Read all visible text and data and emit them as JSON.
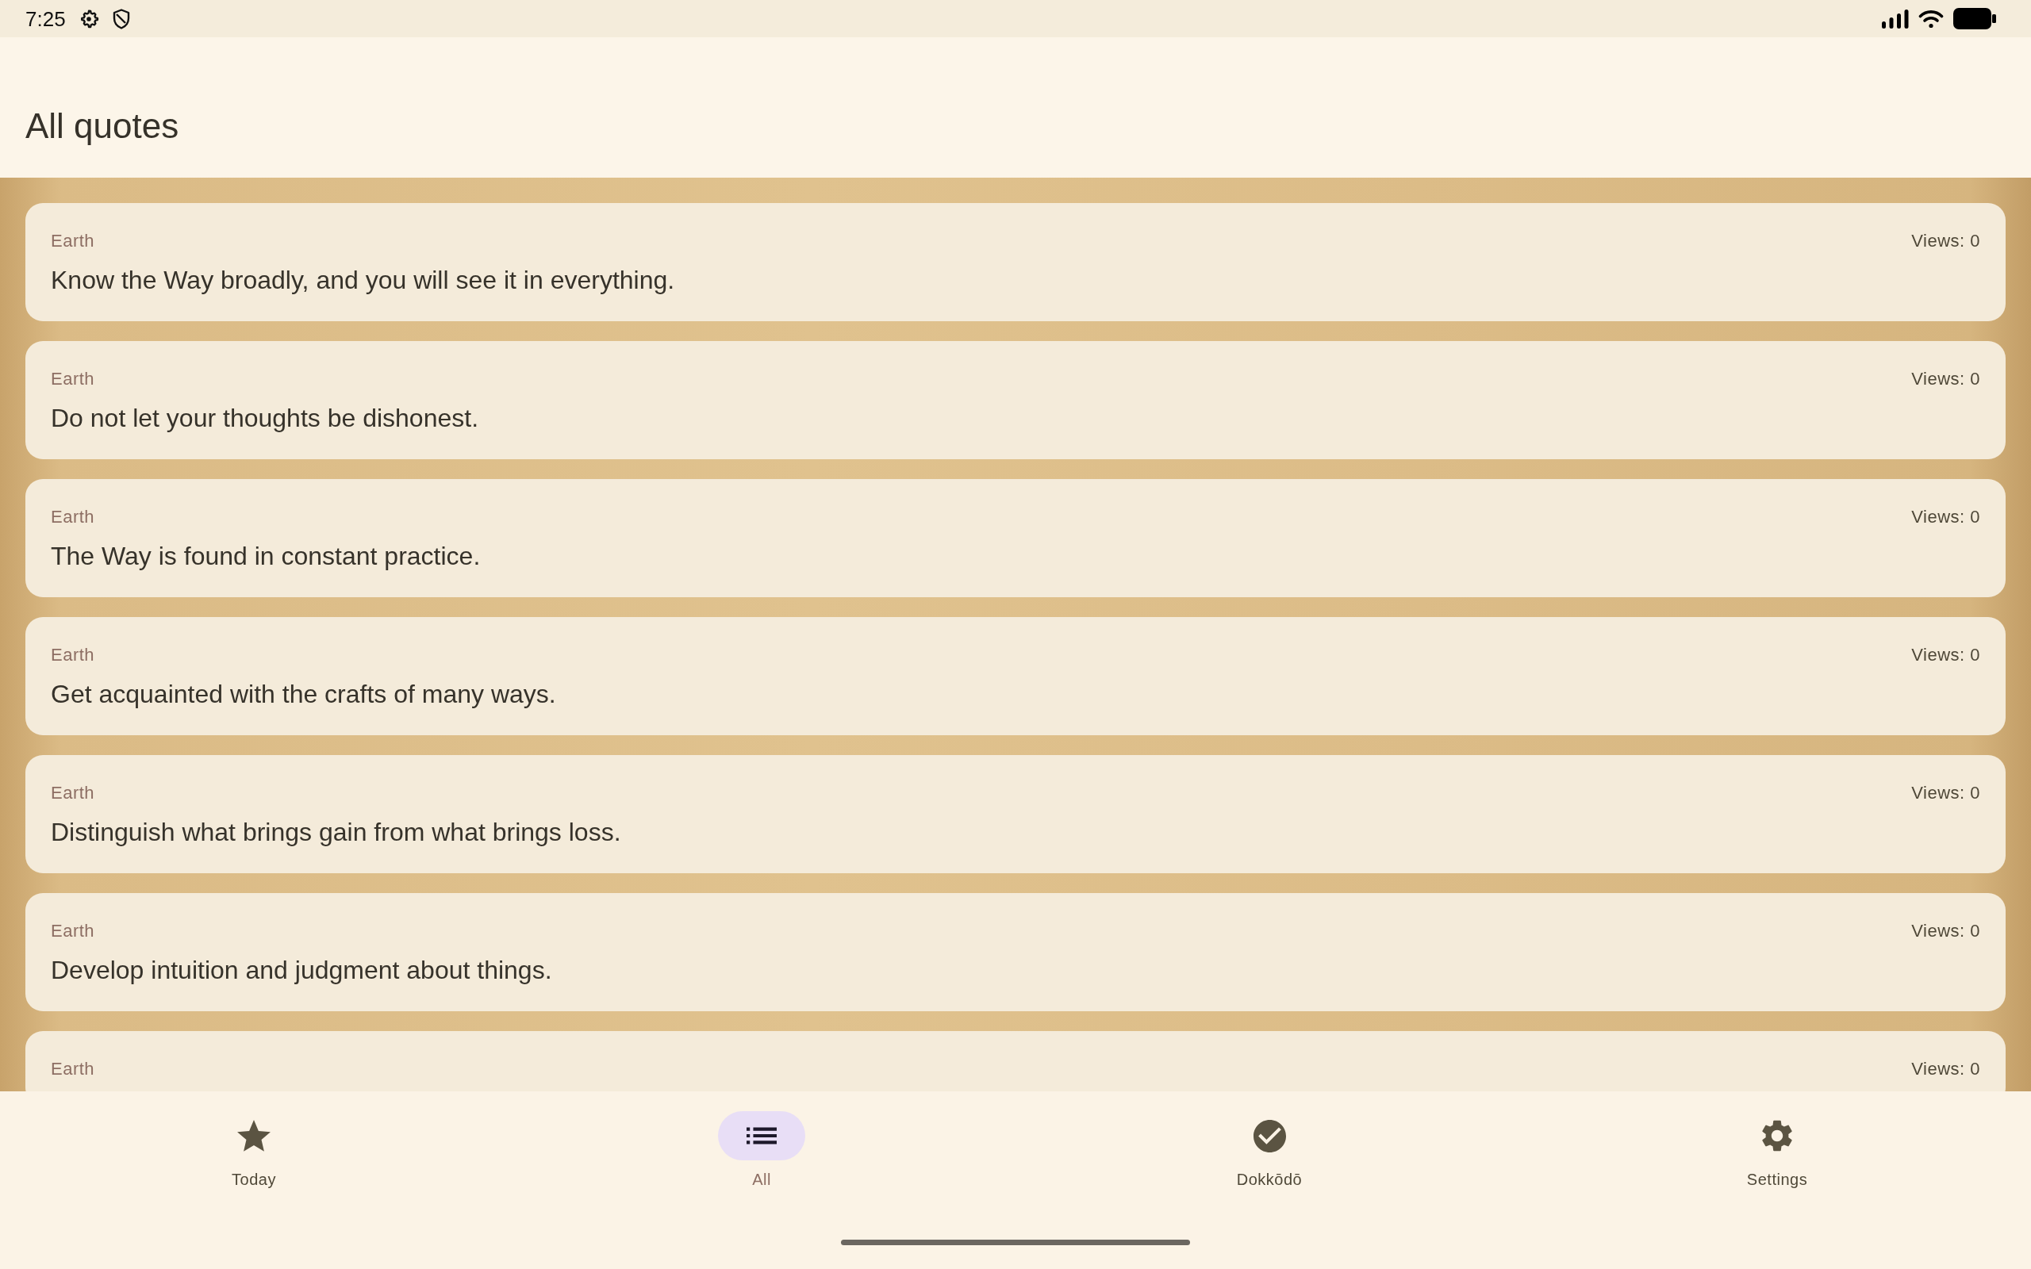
{
  "status_bar": {
    "time": "7:25"
  },
  "header": {
    "title": "All quotes"
  },
  "quotes": [
    {
      "category": "Earth",
      "text": "Know the Way broadly, and you will see it in everything.",
      "views": "Views: 0"
    },
    {
      "category": "Earth",
      "text": "Do not let your thoughts be dishonest.",
      "views": "Views: 0"
    },
    {
      "category": "Earth",
      "text": "The Way is found in constant practice.",
      "views": "Views: 0"
    },
    {
      "category": "Earth",
      "text": "Get acquainted with the crafts of many ways.",
      "views": "Views: 0"
    },
    {
      "category": "Earth",
      "text": "Distinguish what brings gain from what brings loss.",
      "views": "Views: 0"
    },
    {
      "category": "Earth",
      "text": "Develop intuition and judgment about things.",
      "views": "Views: 0"
    },
    {
      "category": "Earth",
      "views": "Views: 0"
    }
  ],
  "nav": {
    "items": [
      {
        "label": "Today",
        "selected": false
      },
      {
        "label": "All",
        "selected": true
      },
      {
        "label": "Dokkōdō",
        "selected": false
      },
      {
        "label": "Settings",
        "selected": false
      }
    ]
  }
}
